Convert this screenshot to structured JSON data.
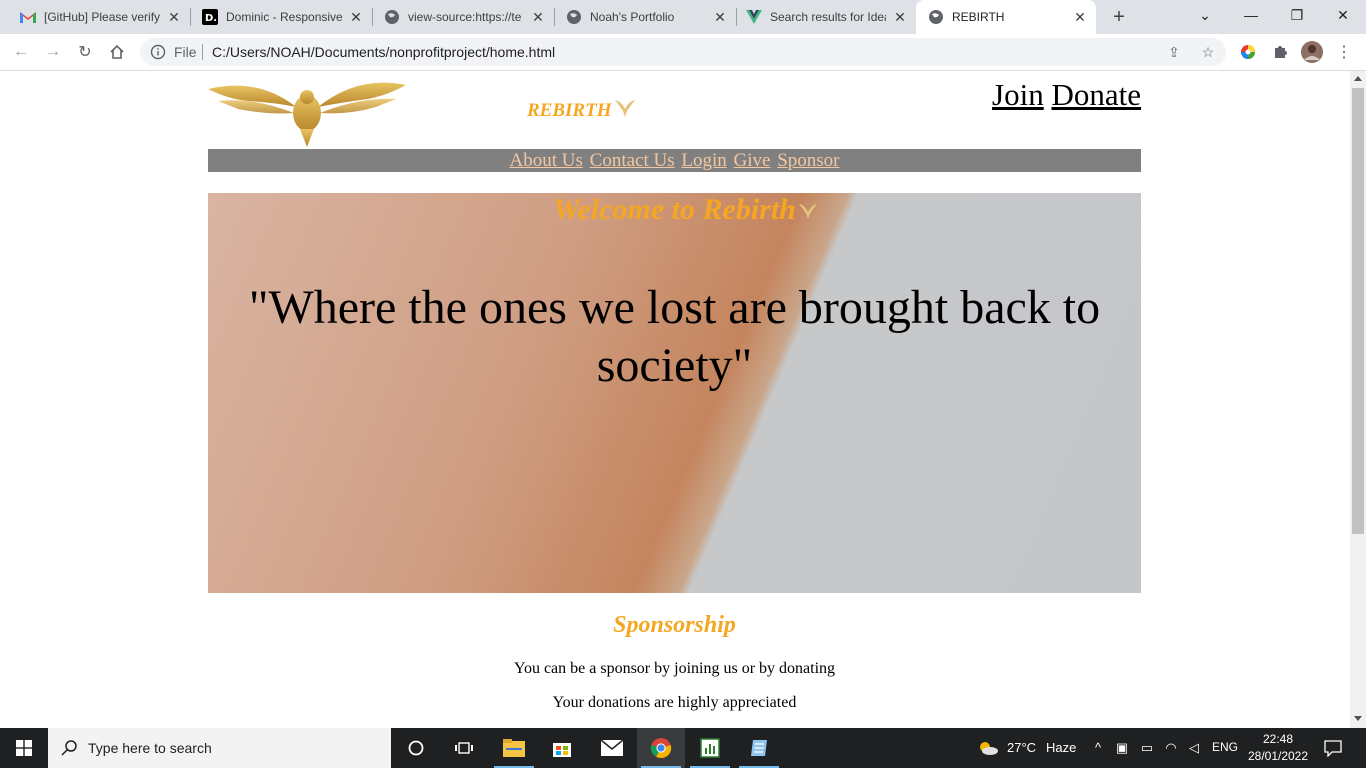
{
  "browser": {
    "tabs": [
      {
        "title": "[GitHub] Please verify",
        "icon": "gmail-icon"
      },
      {
        "title": "Dominic - Responsive",
        "icon": "dev-icon"
      },
      {
        "title": "view-source:https://te",
        "icon": "globe-icon"
      },
      {
        "title": "Noah's Portfolio",
        "icon": "globe-icon"
      },
      {
        "title": "Search results for Idea",
        "icon": "vue-icon"
      },
      {
        "title": "REBIRTH",
        "icon": "globe-icon",
        "active": true
      }
    ],
    "address": {
      "scheme_label": "File",
      "url": "C:/Users/NOAH/Documents/nonprofitproject/home.html"
    }
  },
  "page": {
    "brand": "REBIRTH",
    "top_links": {
      "join": "Join",
      "donate": "Donate"
    },
    "nav": {
      "about": "About Us",
      "contact": "Contact Us",
      "login": "Login",
      "give": "Give",
      "sponsor": "Sponsor"
    },
    "hero": {
      "welcome": "Welcome to Rebirth",
      "quote": "\"Where the ones we lost are brought back to society\""
    },
    "sponsorship": {
      "title": "Sponsorship",
      "line1": "You can be a sponsor by joining us or by donating",
      "line2": "Your donations are highly appreciated"
    }
  },
  "taskbar": {
    "search_placeholder": "Type here to search",
    "weather": {
      "temp": "27°C",
      "condition": "Haze"
    },
    "language": "ENG",
    "time": "22:48",
    "date": "28/01/2022"
  },
  "colors": {
    "accent_orange": "#f5a623",
    "nav_bg": "#808080",
    "nav_link": "#f4c7a0",
    "taskbar_bg": "#1f2021"
  }
}
